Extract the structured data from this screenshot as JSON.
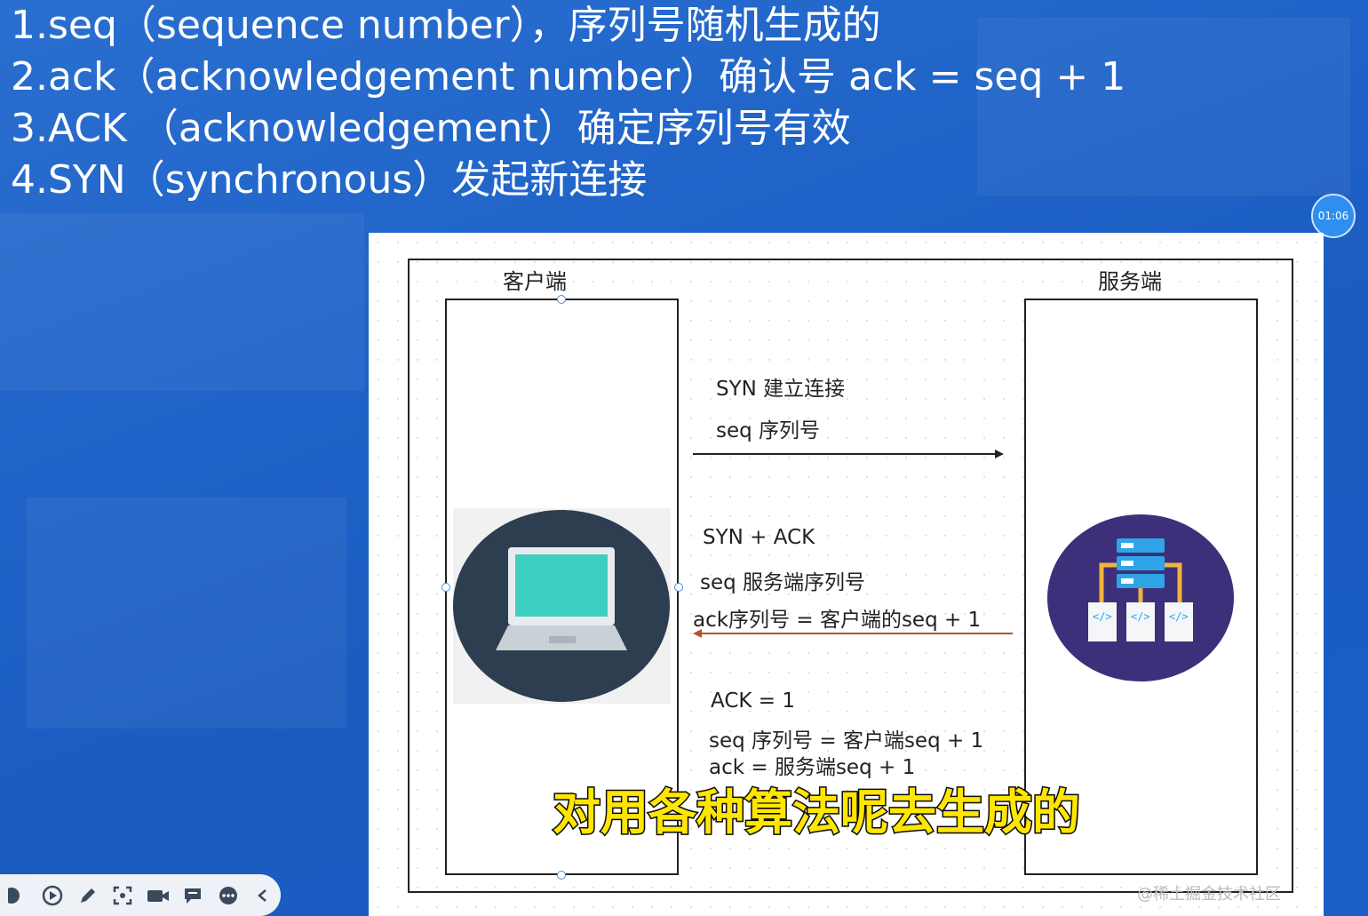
{
  "headlines": [
    "1.seq（sequence number），序列号随机生成的",
    "2.ack（acknowledgement number）确认号 ack = seq + 1",
    "3.ACK （acknowledgement）确定序列号有效",
    "4.SYN（synchronous）发起新连接"
  ],
  "timer": "01:06",
  "diagram": {
    "client_label": "客户端",
    "server_label": "服务端",
    "step1": [
      "SYN  建立连接",
      "seq  序列号"
    ],
    "step2": [
      "SYN + ACK",
      "seq 服务端序列号",
      "ack序列号 = 客户端的seq + 1"
    ],
    "step3": [
      "ACK = 1",
      "seq 序列号 = 客户端seq + 1",
      "ack = 服务端seq + 1"
    ]
  },
  "subtitle": "对用各种算法呢去生成的",
  "watermark": "@稀土掘金技术社区",
  "colors": {
    "background": "#1f63c8",
    "laptop_circle": "#2d3e50",
    "laptop_screen": "#3fcfc0",
    "server_circle": "#3d2f7a",
    "server_block": "#2fa4e7",
    "arrow_request": "#222222",
    "arrow_response": "#b5532a",
    "subtitle": "#ffe600"
  },
  "toolbar_icons": [
    "record-icon",
    "play-icon",
    "pen-icon",
    "screenshot-icon",
    "camera-icon",
    "comment-icon",
    "more-icon",
    "collapse-icon"
  ]
}
